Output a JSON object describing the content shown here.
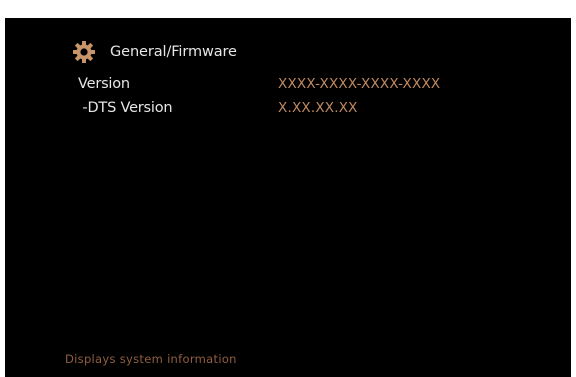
{
  "header": {
    "icon": "gear-icon",
    "title": "General/Firmware"
  },
  "rows": [
    {
      "label": "Version",
      "value": "XXXX-XXXX-XXXX-XXXX"
    },
    {
      "label": " -DTS Version",
      "value": "X.XX.XX.XX"
    }
  ],
  "footer": {
    "help_text": "Displays system information"
  },
  "colors": {
    "background": "#000000",
    "label_text": "#e6e6e6",
    "value_text": "#c08a60",
    "help_text": "#8e5f40",
    "icon": "#c8956a"
  }
}
